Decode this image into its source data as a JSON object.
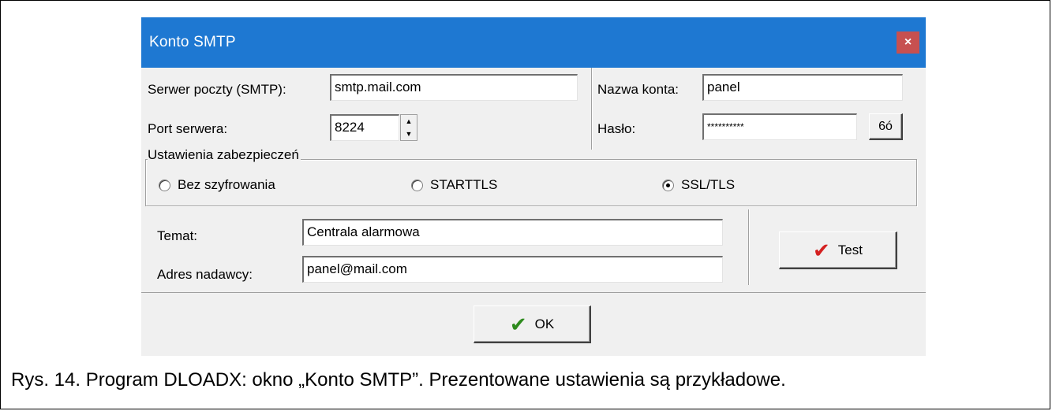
{
  "dialog": {
    "title": "Konto SMTP",
    "close_label": "×"
  },
  "server": {
    "smtp_label": "Serwer poczty (SMTP):",
    "smtp_value": "smtp.mail.com",
    "port_label": "Port serwera:",
    "port_value": "8224"
  },
  "account": {
    "name_label": "Nazwa konta:",
    "name_value": "panel",
    "password_label": "Hasło:",
    "password_value": "**********",
    "show_password_label": "6ó"
  },
  "security": {
    "group_label": "Ustawienia zabezpieczeń",
    "options": [
      {
        "label": "Bez szyfrowania",
        "selected": false
      },
      {
        "label": "STARTTLS",
        "selected": false
      },
      {
        "label": "SSL/TLS",
        "selected": true
      }
    ]
  },
  "message": {
    "subject_label": "Temat:",
    "subject_value": "Centrala alarmowa",
    "sender_label": "Adres nadawcy:",
    "sender_value": "panel@mail.com"
  },
  "buttons": {
    "test_label": "Test",
    "ok_label": "OK",
    "check_color": "#d42020",
    "ok_check_color": "#2e8b1e"
  },
  "caption": "Rys. 14. Program DLOADX: okno „Konto SMTP”. Prezentowane ustawienia są przykładowe."
}
